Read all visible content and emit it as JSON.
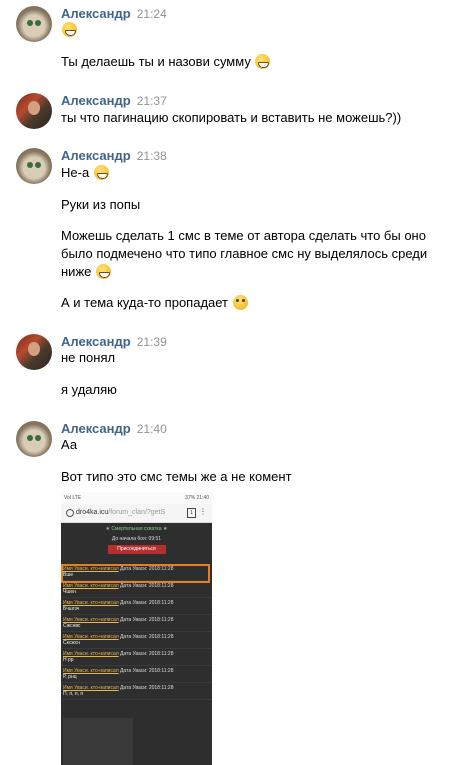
{
  "messages": [
    {
      "author": "Александр",
      "time": "21:24",
      "avatar": "cat-avatar",
      "lines": [
        "",
        "Ты делаешь ты и назови сумму"
      ]
    },
    {
      "author": "Александр",
      "time": "21:37",
      "avatar": "photo-avatar",
      "lines": [
        "ты что пагинацию скопировать и вставить не можешь?))"
      ]
    },
    {
      "author": "Александр",
      "time": "21:38",
      "avatar": "cat-avatar",
      "lines": [
        "Не-а",
        "Руки из попы",
        "Можешь сделать 1 смс в теме от автора сделать что бы оно",
        "было подмечено что типо главное смс ну выделялось среди",
        "ниже",
        "А и тема куда-то пропадает"
      ]
    },
    {
      "author": "Александр",
      "time": "21:39",
      "avatar": "photo-avatar",
      "lines": [
        "не понял",
        "я удаляю"
      ]
    },
    {
      "author": "Александр",
      "time": "21:40",
      "avatar": "cat-avatar",
      "lines": [
        "Аа",
        "Вот типо это смс темы же а не комент"
      ]
    }
  ],
  "emoji": {
    "grin": "grinning-face-emoji",
    "flushed": "flushed-face-emoji"
  },
  "attachment": {
    "status_left": "Vol LTE",
    "status_right": "37% 21:40",
    "url_host": "dro4ka.icu",
    "url_path": "/forum_clan/?getS",
    "tabs_count": "1",
    "forum_title": "★ Смертельная схватка ★",
    "timer": "До начала боя: 09:51",
    "join_label": "Присоединиться",
    "posts": [
      {
        "who": "Имя Уваси. кто-написал",
        "date": "Дата Уваси: 2018:11:28",
        "text": "Вше"
      },
      {
        "who": "Имя Уваси. кто-написал",
        "date": "Дата Уваси: 2018:11:28",
        "text": "Чшен"
      },
      {
        "who": "Имя Уваси. кто-написал",
        "date": "Дата Уваси: 2018:11:28",
        "text": "Бчшгзч"
      },
      {
        "who": "Имя Уваси. кто-написал",
        "date": "Дата Уваси: 2018:11:28",
        "text": "Сжснвс"
      },
      {
        "who": "Имя Уваси. кто-написал",
        "date": "Дата Уваси: 2018:11:28",
        "text": "Сксжсн"
      },
      {
        "who": "Имя Уваси. кто-написал",
        "date": "Дата Уваси: 2018:11:28",
        "text": "Н рр"
      },
      {
        "who": "Имя Уваси. кто-написал",
        "date": "Дата Уваси: 2018:11:28",
        "text": "Р, рнц"
      },
      {
        "who": "Имя Уваси. кто-написал",
        "date": "Дата Уваси: 2018:11:28",
        "text": "П, п, п, п"
      }
    ]
  }
}
